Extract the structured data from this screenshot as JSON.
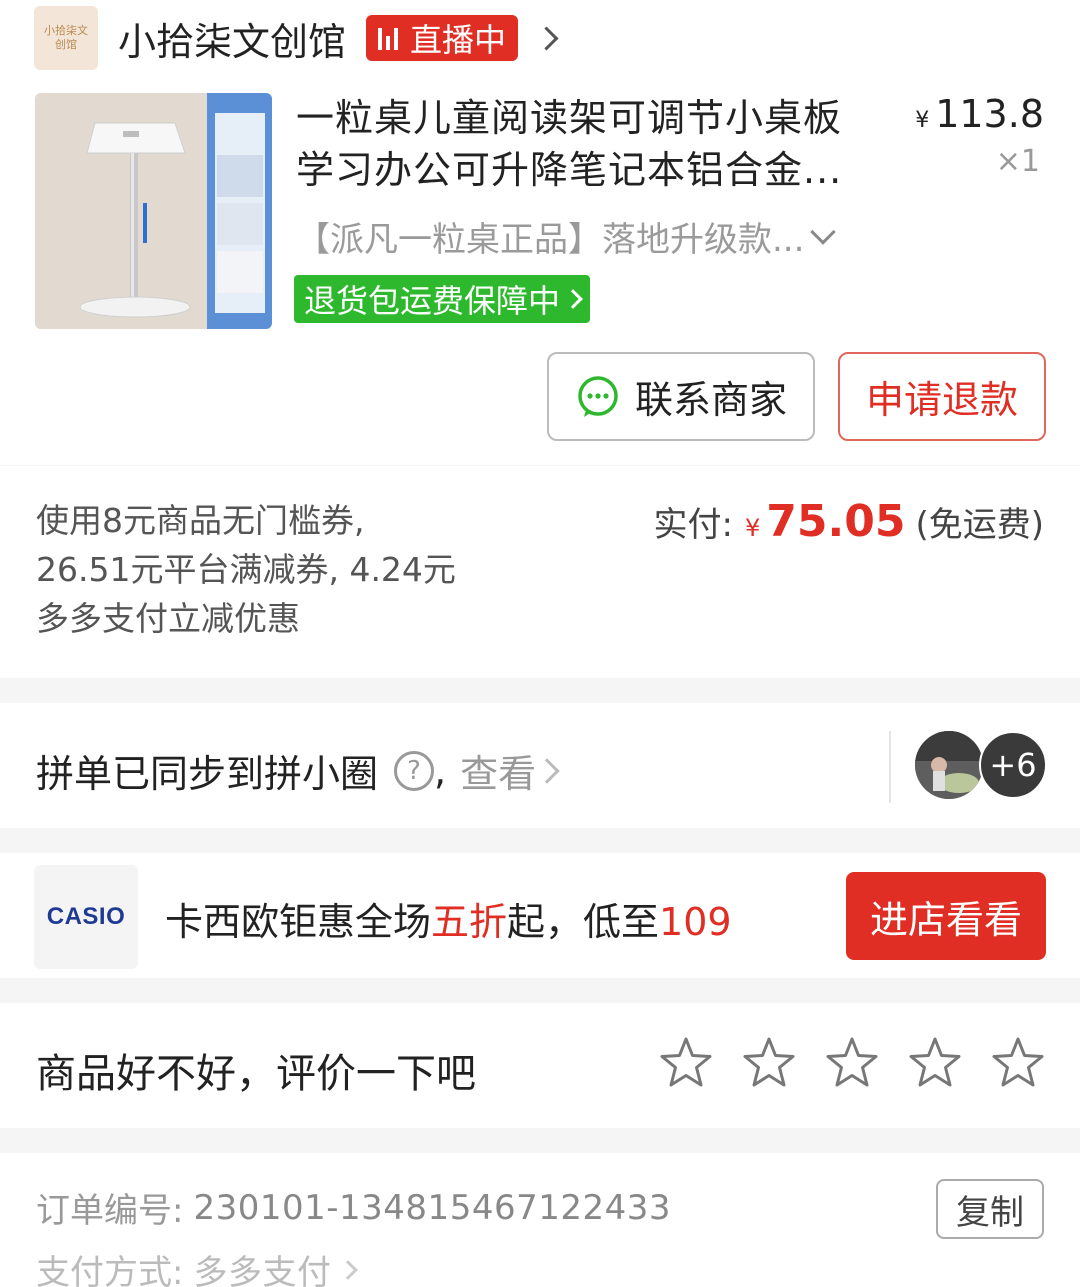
{
  "shop": {
    "logo_text": "小拾柒文创馆",
    "name": "小拾柒文创馆",
    "live_label": "直播中"
  },
  "product": {
    "title": "一粒桌儿童阅读架可调节小桌板学习办公可升降笔记本铝合金...",
    "price_symbol": "¥",
    "price": "113.8",
    "quantity": "×1",
    "spec": "【派凡一粒桌正品】落地升级款...",
    "return_badge": "退货包运费保障中"
  },
  "actions": {
    "contact_label": "联系商家",
    "refund_label": "申请退款"
  },
  "payment": {
    "coupon_text": "使用8元商品无门槛券, 26.51元平台满减券, 4.24元多多支付立减优惠",
    "paid_label": "实付:",
    "currency": "¥",
    "amount": "75.05",
    "shipping_note": "(免运费)"
  },
  "share": {
    "label": "拼单已同步到拼小圈",
    "help_symbol": "?",
    "separator": ",",
    "view_label": "查看",
    "extra_count": "+6"
  },
  "ad": {
    "brand": "CASIO",
    "text_before": "卡西欧钜惠全场",
    "highlight_1": "五折",
    "text_middle": "起，低至",
    "highlight_2": "109",
    "button_label": "进店看看"
  },
  "rating": {
    "prompt": "商品好不好，评价一下吧",
    "stars_total": 5,
    "stars_selected": 0
  },
  "info": {
    "order_label": "订单编号:",
    "order_number": "230101-134815467122433",
    "copy_label": "复制",
    "pay_label": "支付方式:",
    "pay_method": "多多支付"
  },
  "colors": {
    "accent_red": "#e02e24",
    "return_green": "#2db82d",
    "brand_blue": "#1f3a93"
  }
}
